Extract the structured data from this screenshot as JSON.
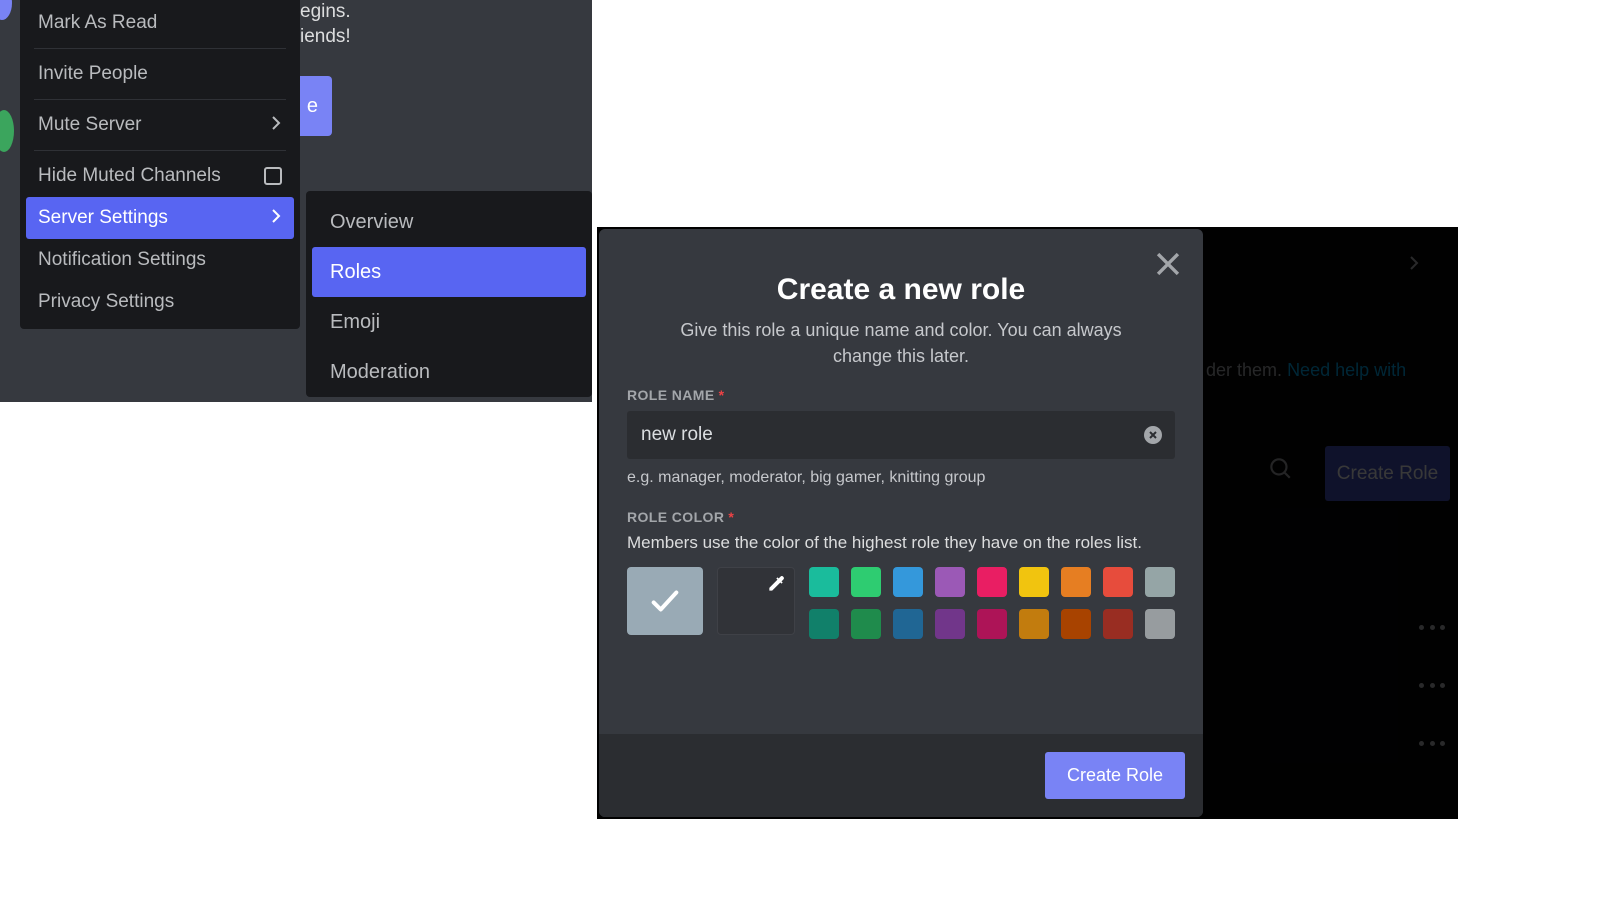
{
  "left": {
    "backdrop": {
      "line1": "egins.",
      "line2": "iends!",
      "button_tail": "e"
    },
    "context_menu": [
      {
        "label": "Mark As Read",
        "type": "plain"
      },
      {
        "sep": true
      },
      {
        "label": "Invite People",
        "type": "plain"
      },
      {
        "sep": true
      },
      {
        "label": "Mute Server",
        "type": "arrow"
      },
      {
        "sep": true
      },
      {
        "label": "Hide Muted Channels",
        "type": "checkbox"
      },
      {
        "label": "Server Settings",
        "type": "arrow",
        "selected": true
      },
      {
        "label": "Notification Settings",
        "type": "plain"
      },
      {
        "label": "Privacy Settings",
        "type": "plain"
      }
    ],
    "submenu": [
      {
        "label": "Overview"
      },
      {
        "label": "Roles",
        "selected": true
      },
      {
        "label": "Emoji"
      },
      {
        "label": "Moderation"
      }
    ]
  },
  "right": {
    "bg": {
      "text_tail": "der them.",
      "link_tail": "Need help with",
      "create_btn": "Create Role"
    },
    "modal": {
      "title": "Create a new role",
      "description": "Give this role a unique name and color. You can always change this later.",
      "role_name_label": "ROLE NAME",
      "role_name_value": "new role",
      "role_name_hint": "e.g. manager, moderator, big gamer, knitting group",
      "role_color_label": "ROLE COLOR",
      "role_color_desc": "Members use the color of the highest role they have on the roles list.",
      "colors_row1": [
        "#1abc9c",
        "#2ecc71",
        "#3498db",
        "#9b59b6",
        "#e91e63",
        "#f1c40f",
        "#e67e22",
        "#e74c3c",
        "#95a5a6"
      ],
      "colors_row2": [
        "#11806a",
        "#1f8b4c",
        "#206694",
        "#71368a",
        "#ad1457",
        "#c27c0e",
        "#a84300",
        "#992d22",
        "#979c9f"
      ],
      "footer_button": "Create Role"
    }
  }
}
